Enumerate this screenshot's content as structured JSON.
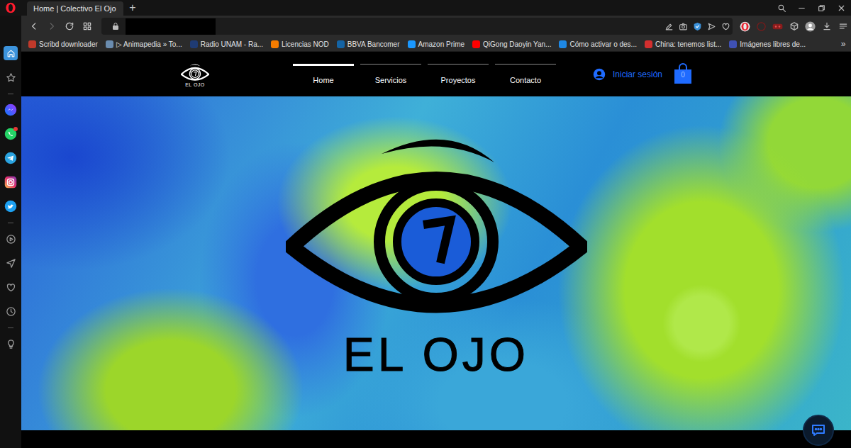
{
  "tabs": [
    {
      "label": "Home | Colectivo El Ojo",
      "selected": true
    }
  ],
  "new_tab": "+",
  "address_bar": {
    "url_hidden": true
  },
  "bookmarks": [
    {
      "label": "Scribd downloader",
      "color": "#c0392b"
    },
    {
      "label": "▷ Animapedia » To...",
      "color": "#6a8caf"
    },
    {
      "label": "Radio UNAM - Ra...",
      "color": "#1f3b73"
    },
    {
      "label": "Licencias NOD",
      "color": "#f57c00"
    },
    {
      "label": "BBVA Bancomer",
      "color": "#1464a5"
    },
    {
      "label": "Amazon Prime",
      "color": "#1a98ff"
    },
    {
      "label": "QiGong Daoyin Yan...",
      "color": "#ff0000"
    },
    {
      "label": "Cómo activar o des...",
      "color": "#1e88e5"
    },
    {
      "label": "China: tenemos list...",
      "color": "#d32f2f"
    },
    {
      "label": "Imágenes libres de...",
      "color": "#3f51b5"
    }
  ],
  "bookmarks_more": "»",
  "sidebar": {
    "items": [
      {
        "kind": "home",
        "selected": true,
        "notified": false
      },
      {
        "kind": "star",
        "selected": false,
        "notified": false
      },
      {
        "kind": "separator",
        "selected": false,
        "notified": false
      },
      {
        "kind": "messenger",
        "selected": false,
        "notified": false
      },
      {
        "kind": "whatsapp",
        "selected": false,
        "notified": true
      },
      {
        "kind": "telegram",
        "selected": false,
        "notified": false
      },
      {
        "kind": "instagram",
        "selected": false,
        "notified": false
      },
      {
        "kind": "twitter",
        "selected": false,
        "notified": false
      },
      {
        "kind": "separator",
        "selected": false,
        "notified": false
      },
      {
        "kind": "player",
        "selected": false,
        "notified": false
      },
      {
        "kind": "send",
        "selected": false,
        "notified": false
      },
      {
        "kind": "heart",
        "selected": false,
        "notified": false
      },
      {
        "kind": "clock",
        "selected": false,
        "notified": false
      },
      {
        "kind": "separator",
        "selected": false,
        "notified": false
      },
      {
        "kind": "bulb",
        "selected": false,
        "notified": false
      }
    ]
  },
  "site": {
    "logo": {
      "text": "EL OJO"
    },
    "nav": [
      {
        "label": "Home",
        "selected": true
      },
      {
        "label": "Servicios",
        "selected": false
      },
      {
        "label": "Proyectos",
        "selected": false
      },
      {
        "label": "Contacto",
        "selected": false
      }
    ],
    "login": "Iniciar sesión",
    "cart_count": "0",
    "hero": {
      "title": "EL OJO"
    }
  }
}
